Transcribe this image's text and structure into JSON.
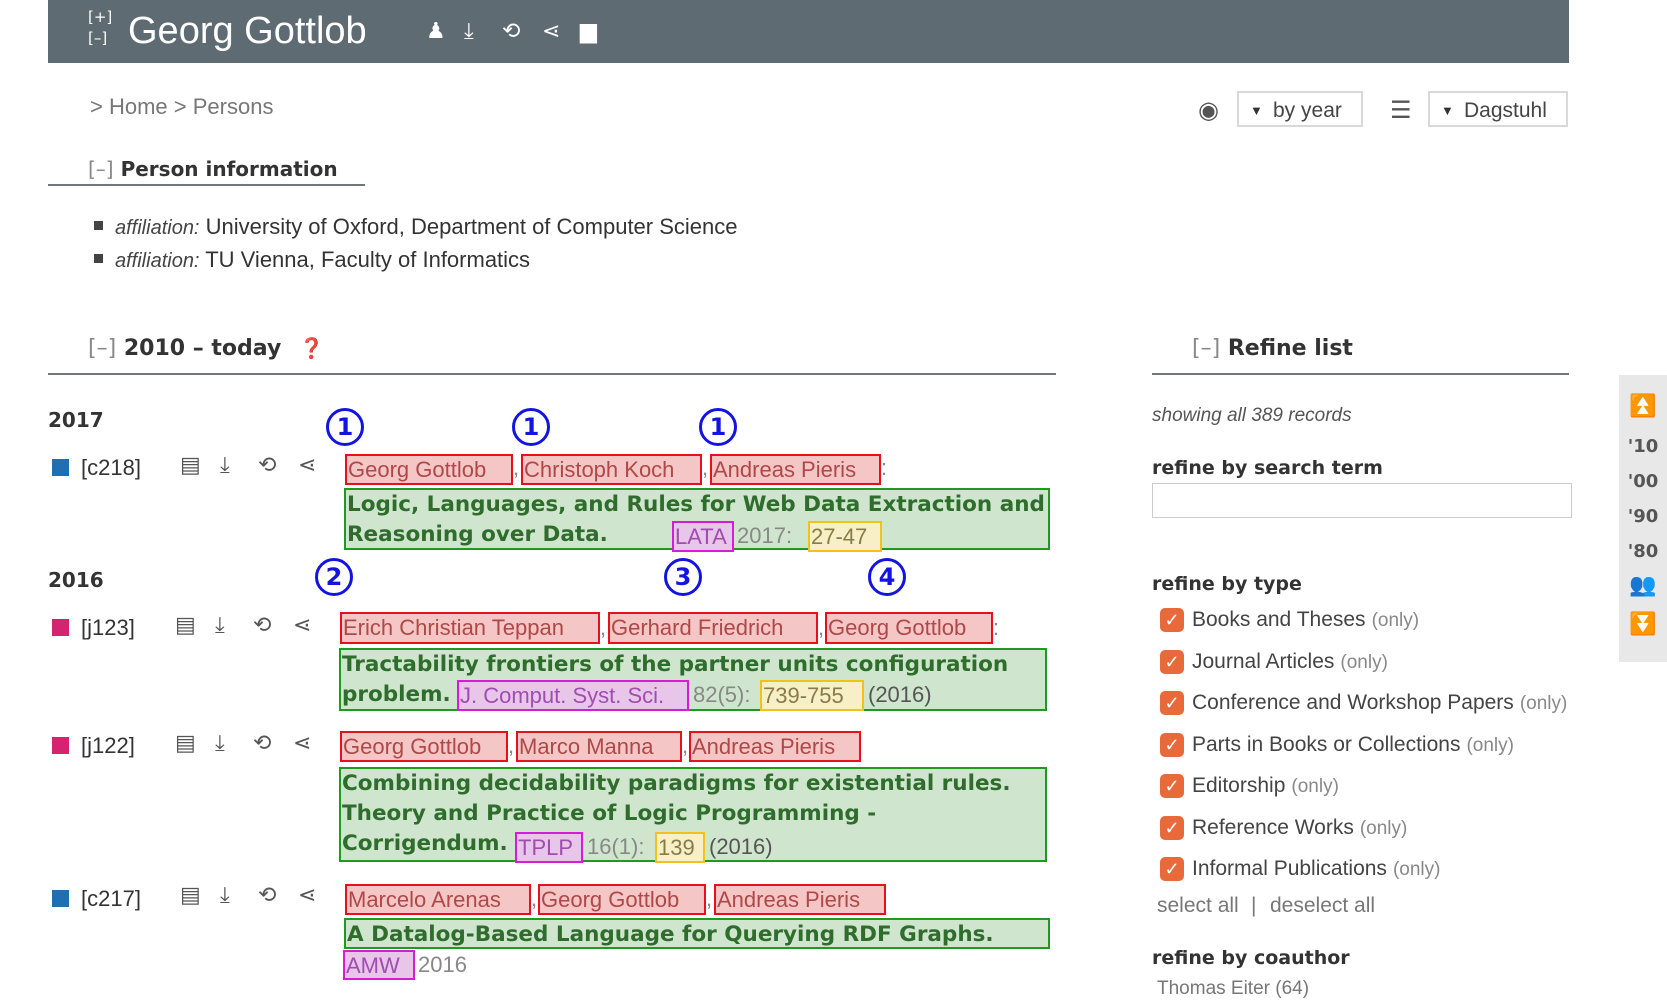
{
  "header": {
    "expand_label": "[+]",
    "collapse_label": "[–]",
    "person_name": "Georg Gottlob",
    "icons": [
      "person-icon",
      "download-icon",
      "export-icon",
      "share-icon",
      "comment-icon"
    ]
  },
  "breadcrumb": {
    "home": "> Home",
    "persons": "> Persons"
  },
  "settings": {
    "view_icon": "eye-icon",
    "order_label": "by year",
    "db_icon": "database-icon",
    "mirror_label": "Dagstuhl"
  },
  "person_info": {
    "toggle": "[–]",
    "title": "Person information",
    "affiliations": [
      {
        "label": "affiliation:",
        "value": "University of Oxford, Department of Computer Science"
      },
      {
        "label": "affiliation:",
        "value": "TU Vienna, Faculty of Informatics"
      }
    ]
  },
  "publications_section": {
    "toggle": "[–]",
    "title": "2010 – today",
    "help_icon": "help-icon"
  },
  "years": [
    "2017",
    "2016"
  ],
  "publications": [
    {
      "key": "[c218]",
      "type_color": "#1f6fb5",
      "authors": [
        "Georg Gottlob",
        "Christoph Koch",
        "Andreas Pieris"
      ],
      "title": "Logic, Languages, and Rules for Web Data Extraction and Reasoning over Data.",
      "venue": "LATA",
      "mid": "2017:",
      "pages": "27-47",
      "after": ""
    },
    {
      "key": "[j123]",
      "type_color": "#d4246f",
      "authors": [
        "Erich Christian Teppan",
        "Gerhard Friedrich",
        "Georg Gottlob"
      ],
      "title": "Tractability frontiers of the partner units configuration problem.",
      "venue": "J. Comput. Syst. Sci.",
      "mid": "82(5):",
      "pages": "739-755",
      "after": "(2016)"
    },
    {
      "key": "[j122]",
      "type_color": "#d4246f",
      "authors": [
        "Georg Gottlob",
        "Marco Manna",
        "Andreas Pieris"
      ],
      "title": "Combining decidability paradigms for existential rules. Theory and Practice of Logic Programming - Corrigendum.",
      "venue": "TPLP",
      "mid": "16(1):",
      "pages": "139",
      "after": "(2016)"
    },
    {
      "key": "[c217]",
      "type_color": "#1f6fb5",
      "authors": [
        "Marcelo Arenas",
        "Georg Gottlob",
        "Andreas Pieris"
      ],
      "title": "A Datalog-Based Language for Querying RDF Graphs.",
      "venue": "AMW",
      "mid": "2016",
      "pages": "",
      "after": ""
    }
  ],
  "badges": [
    "1",
    "1",
    "1",
    "2",
    "3",
    "4"
  ],
  "refine": {
    "toggle": "[–]",
    "title": "Refine list",
    "showing": "showing all 389 records",
    "search_label": "refine by search term",
    "search_value": "",
    "type_label": "refine by type",
    "types": [
      "Books and Theses",
      "Journal Articles",
      "Conference and Workshop Papers",
      "Parts in Books or Collections",
      "Editorship",
      "Reference Works",
      "Informal Publications"
    ],
    "only_label": "(only)",
    "select_all": "select all",
    "divider": "|",
    "deselect_all": "deselect all",
    "coauthor_label": "refine by coauthor",
    "coauthors": [
      "Thomas Eiter (64)"
    ]
  },
  "year_nav": {
    "items": [
      "'10",
      "'00",
      "'90",
      "'80"
    ],
    "top_icon": "jump-top-icon",
    "coauthor_icon": "coauthors-icon",
    "bottom_icon": "jump-bottom-icon"
  }
}
